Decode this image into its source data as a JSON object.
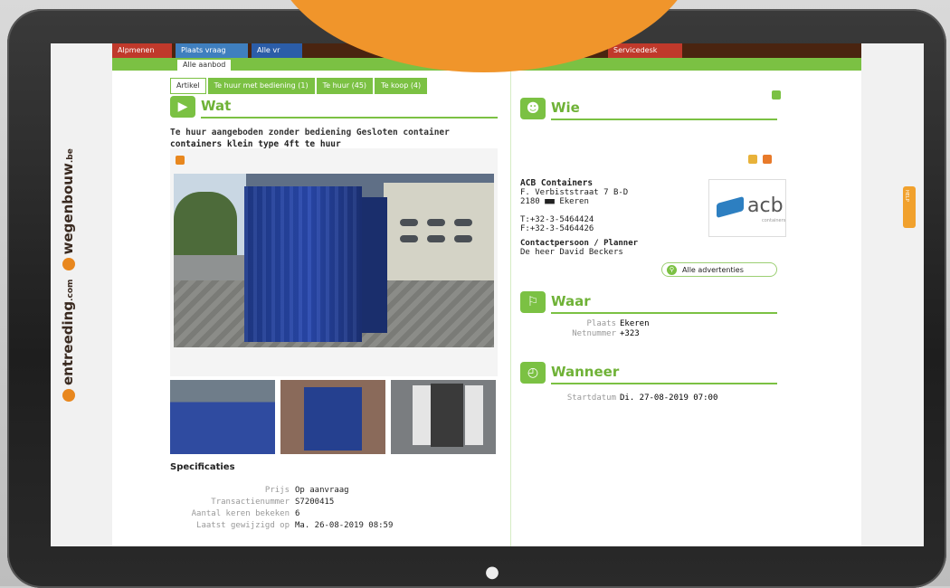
{
  "topnav": {
    "items": [
      "Alpmenen",
      "Plaats vraag",
      "Alle vr"
    ],
    "right_item": "Servicedesk"
  },
  "subnav": {
    "tab": "Alle aanbod"
  },
  "brand": {
    "name1": "entreeding",
    "tld1": ".com",
    "name2": "wegenbouw",
    "tld2": ".be"
  },
  "tabs": [
    "Artikel",
    "Te huur met bediening (1)",
    "Te huur (45)",
    "Te koop (4)"
  ],
  "wat": {
    "heading": "Wat",
    "line1": "Te huur aangeboden zonder bediening Gesloten container",
    "line2": "containers klein type 4ft te huur"
  },
  "specs": {
    "title": "Specificaties",
    "rows": [
      {
        "k": "Prijs",
        "v": "Op aanvraag"
      },
      {
        "k": "Transactienummer",
        "v": "S7200415"
      },
      {
        "k": "Aantal keren bekeken",
        "v": "6"
      },
      {
        "k": "Laatst gewijzigd op",
        "v": "Ma. 26-08-2019 08:59"
      }
    ]
  },
  "wie": {
    "heading": "Wie",
    "company": "ACB Containers",
    "street": "F. Verbiststraat 7 B-D",
    "city": "2180 ■■ Ekeren",
    "phone": "T:+32-3-5464424",
    "fax": "F:+32-3-5464426",
    "contact_title": "Contactpersoon / Planner",
    "contact_name": "De heer David Beckers",
    "ads_button": "Alle advertenties",
    "logo_word": "acb",
    "logo_sub": "containers"
  },
  "waar": {
    "heading": "Waar",
    "plaats_k": "Plaats",
    "plaats_v": "Ekeren",
    "net_k": "Netnummer",
    "net_v": "+323"
  },
  "wanneer": {
    "heading": "Wanneer",
    "start_k": "Startdatum",
    "start_v": "Di. 27-08-2019 07:00"
  },
  "help_label": "HELP",
  "colors": {
    "accent_green": "#7bc143",
    "brand_orange": "#f0952b",
    "nav_brown": "#4a2410"
  }
}
